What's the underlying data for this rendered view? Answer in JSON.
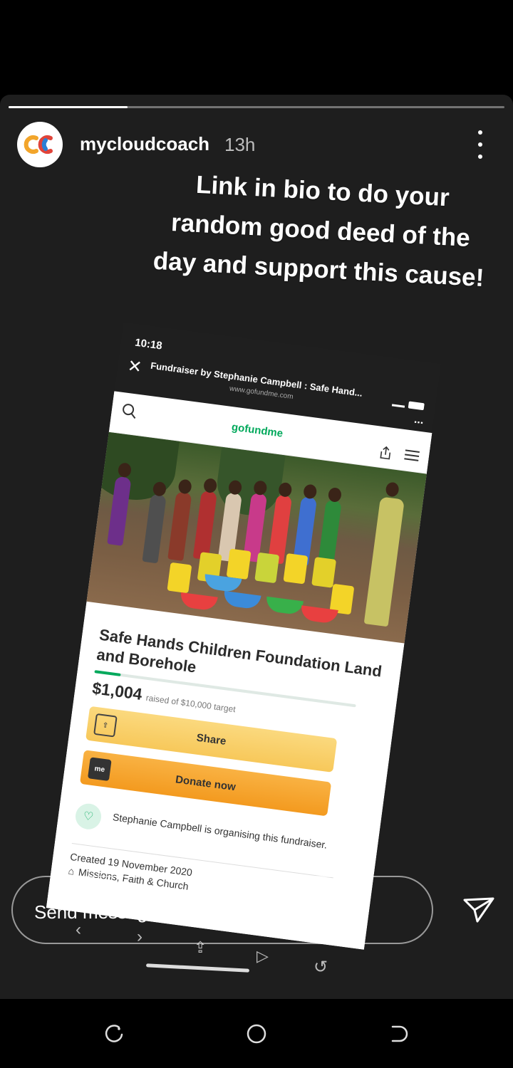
{
  "story": {
    "progress": 0.24,
    "username": "mycloudcoach",
    "time": "13h",
    "caption": "Link in bio to do your random good deed of the day and support this cause!",
    "reply_placeholder": "Send message"
  },
  "screenshot": {
    "status_time": "10:18",
    "browser_title": "Fundraiser by Stephanie Campbell : Safe Hand...",
    "browser_url": "www.gofundme.com",
    "browser_more": "...",
    "logo": "gofundme",
    "campaign_title": "Safe Hands Children Foundation Land and Borehole",
    "raised_amount": "$1,004",
    "raised_target": "raised of $10,000 target",
    "progress": 0.1,
    "share_label": "Share",
    "donate_label": "Donate now",
    "donate_icon_text": "me",
    "organiser_text": "Stephanie Campbell is organising this fundraiser.",
    "created": "Created 19 November 2020",
    "category": "Missions, Faith & Church"
  },
  "icons": {
    "avatar": "mycloudcoach-logo",
    "more": "more-vertical-icon",
    "send": "paper-plane-icon"
  },
  "colors": {
    "story_bg": "#1e1e1e",
    "gofundme_green": "#02a95c",
    "share_button": "#f7c85a",
    "donate_button": "#f39a1f"
  }
}
